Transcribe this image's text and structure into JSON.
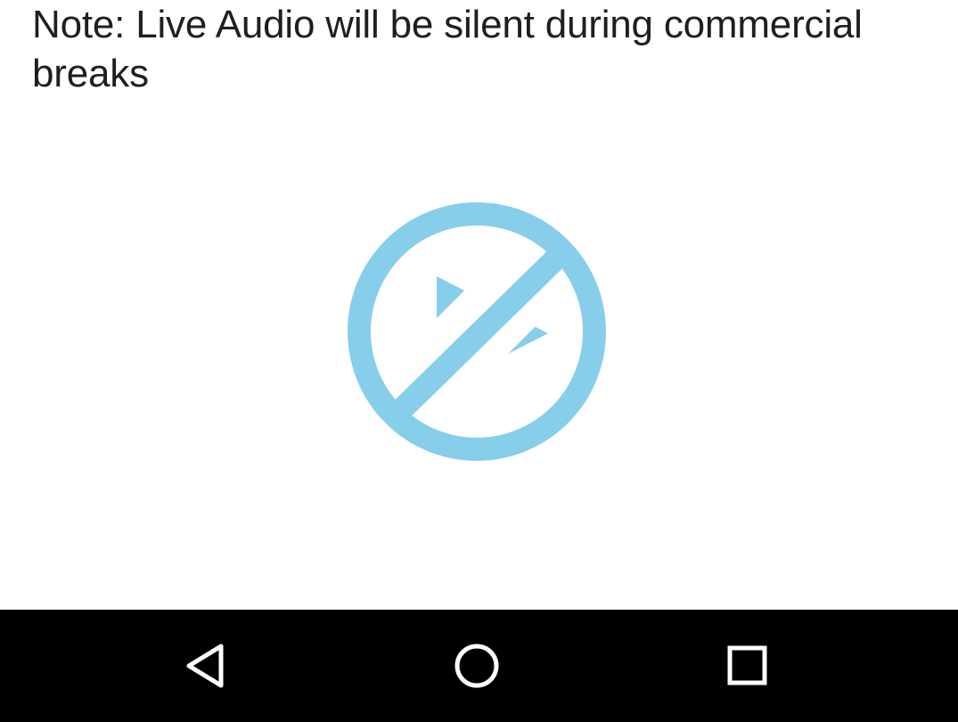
{
  "notice": {
    "text": "Note: Live Audio will be silent during commercial breaks"
  },
  "status_icon": {
    "name": "no-playback-icon",
    "color": "#87CEEB"
  },
  "navigation_bar": {
    "background": "#000000",
    "icon_color": "#FFFFFF",
    "buttons": [
      {
        "name": "back-icon"
      },
      {
        "name": "home-icon"
      },
      {
        "name": "recents-icon"
      }
    ]
  }
}
